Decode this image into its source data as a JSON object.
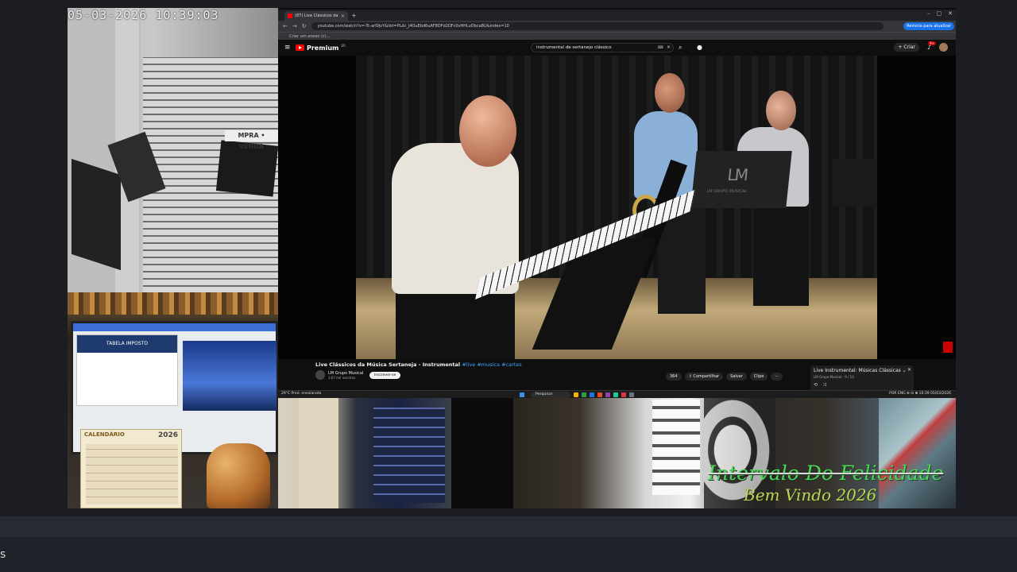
{
  "cctv": {
    "timestamp": "05-03-2026  10:39:03",
    "sign": "MPRA • VENDA"
  },
  "browser": {
    "tab_title": "(87) Live Clássicos da Mú",
    "url": "youtube.com/watch?v=-Tc-arl0jvY&list=PLdc_j4OuEbd6uAF8DFd2DFc0vHHLvDbcaBU&index=10",
    "bookmark": "Criar um anexo (c)...",
    "relaunch": "Reinicie para atualizar"
  },
  "youtube": {
    "logo": "Premium",
    "logo_sup": "BR",
    "search_query": "instrumental de sertanejo clássico",
    "create": "+ Criar",
    "bell_badge": "9+",
    "stand_logo": "LM",
    "stand_label": "LM GRUPO MUSICAL",
    "video_title": "Live Clássicos da Música Sertaneja - Instrumental ",
    "video_tags": "#live #musica #cartes",
    "channel": "LM Grupo Musical",
    "subs": "3,67 mil inscritos",
    "subscribe": "Inscrever-se",
    "actions": [
      "364",
      "⇪ Compartilhar",
      "Salvar",
      "Clipe",
      "⋯"
    ],
    "playlist_title": "Live Instrumental: Músicas Clássicas ⌄",
    "playlist_sub": "LM Grupo Musical · 9 / 10",
    "playlist_close": "×"
  },
  "taskbar": {
    "weather": "29°C  Pred. ensolarado",
    "search": "Pesquisar",
    "tray": "POR  ENG  ⊕  ⊡  ⊞   10:39  05/03/2026"
  },
  "overlay": {
    "line1": "Intervalo Do Felicidade",
    "line2": "Bem Vindo 2026"
  },
  "desk": {
    "cal_title": "CALENDÁRIO",
    "cal_year": "2026",
    "monitor_head": "TABELA IMPOSTO"
  },
  "footer": {
    "left_char": "s"
  },
  "colors": {
    "accent_red": "#ff0000",
    "overlay_green": "#4bd65a",
    "overlay_yellow": "#b9d85a"
  }
}
